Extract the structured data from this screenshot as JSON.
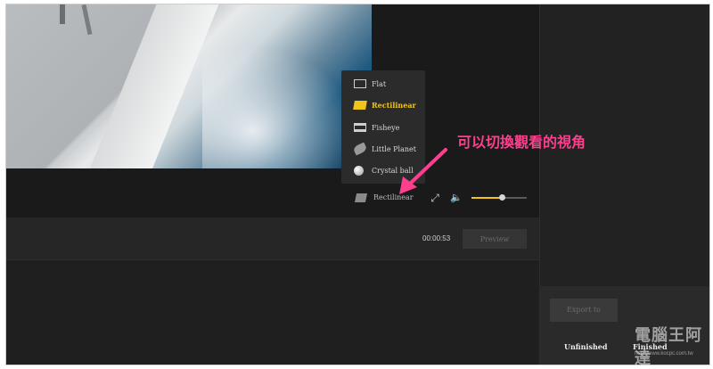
{
  "player": {
    "projection_menu": {
      "items": [
        {
          "label": "Flat",
          "icon": "flat-icon",
          "active": false
        },
        {
          "label": "Rectilinear",
          "icon": "rectilinear-icon",
          "active": true
        },
        {
          "label": "Fisheye",
          "icon": "fisheye-icon",
          "active": false
        },
        {
          "label": "Little Planet",
          "icon": "little-planet-icon",
          "active": false
        },
        {
          "label": "Crystal ball",
          "icon": "crystal-ball-icon",
          "active": false
        }
      ]
    },
    "controls": {
      "projection_label": "Rectilinear",
      "volume_level": 0.55
    },
    "timecode": "00:00:53",
    "preview_label": "Preview"
  },
  "sidebar": {
    "export_label": "Export to",
    "tabs": [
      "Unfinished",
      "Finished"
    ]
  },
  "annotation": "可以切換觀看的視角",
  "watermark": {
    "text": "電腦王阿達",
    "url": "http://www.kocpc.com.tw"
  },
  "colors": {
    "accent": "#f0c419",
    "annotation": "#ff3f8e",
    "background": "#1c1c1c"
  }
}
